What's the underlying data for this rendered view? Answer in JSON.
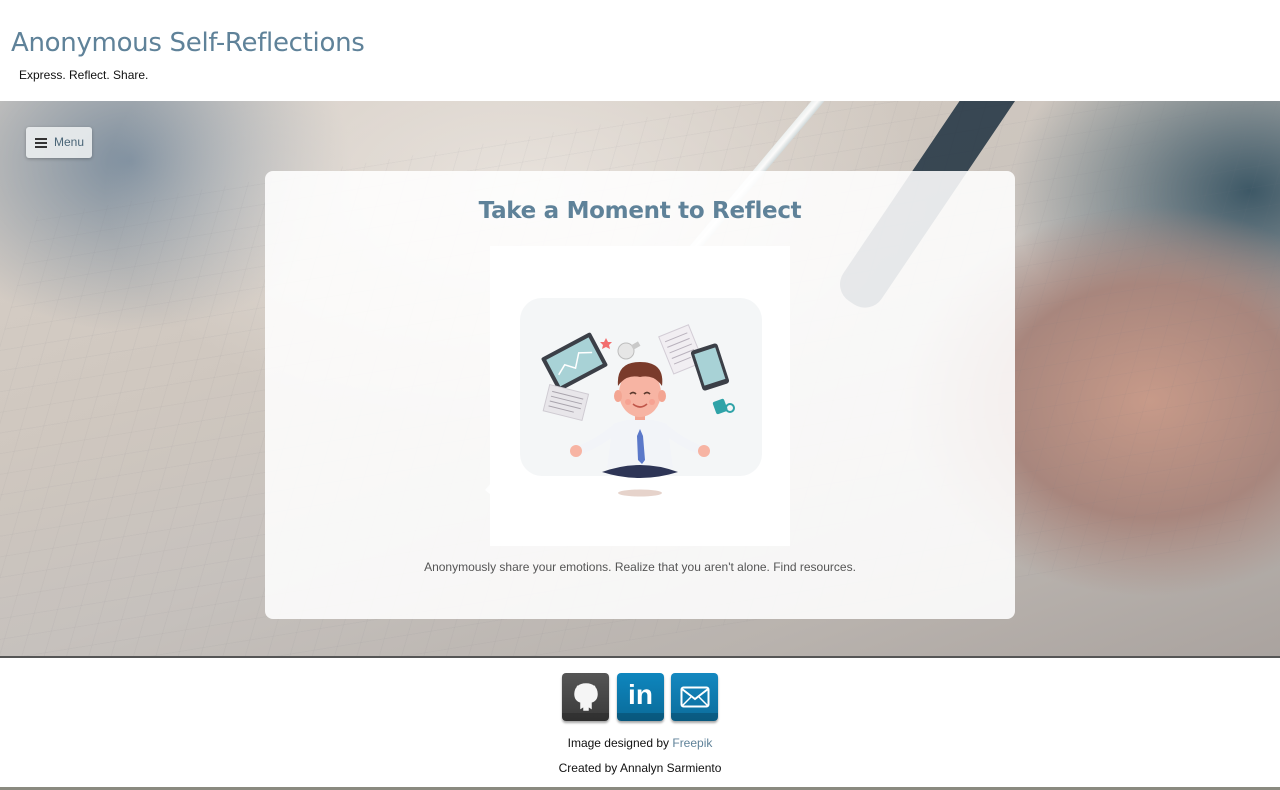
{
  "header": {
    "site_title": "Anonymous Self-Reflections",
    "tagline": "Express. Reflect. Share."
  },
  "nav": {
    "menu_label": "Menu",
    "menu_icon": "hamburger-icon"
  },
  "card": {
    "title": "Take a Moment to Reflect",
    "caption": "Anonymously share your emotions. Realize that you aren't alone. Find resources."
  },
  "footer": {
    "social": [
      {
        "name": "github",
        "icon": "github-icon"
      },
      {
        "name": "linkedin",
        "icon": "linkedin-icon",
        "text": "in"
      },
      {
        "name": "email",
        "icon": "email-icon"
      }
    ],
    "image_credit_prefix": "Image designed by",
    "image_credit_link": "Freepik",
    "created_by": "Created by Annalyn Sarmiento"
  },
  "colors": {
    "title_accent": "#5f8299",
    "github_bg": "#444444",
    "linkedin_bg": "#0e86be",
    "email_bg": "#1488c0"
  }
}
